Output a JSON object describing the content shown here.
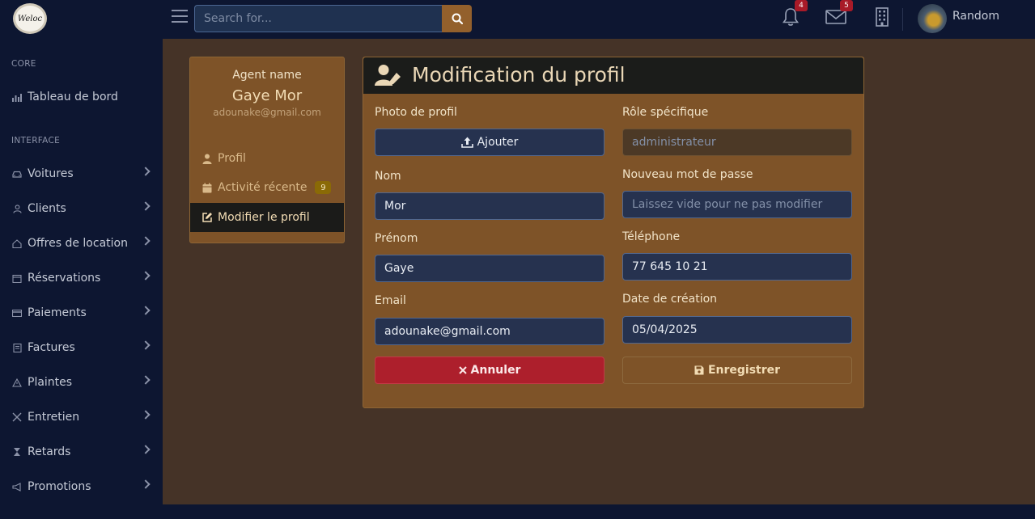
{
  "brand": {
    "logo_text": "Weloc"
  },
  "sidebar": {
    "core_heading": "CORE",
    "dashboard_label": "Tableau de bord",
    "interface_heading": "INTERFACE",
    "items": [
      {
        "label": "Voitures",
        "icon": "car-icon"
      },
      {
        "label": "Clients",
        "icon": "user-icon"
      },
      {
        "label": "Offres de location",
        "icon": "home-icon"
      },
      {
        "label": "Réservations",
        "icon": "calendar-icon"
      },
      {
        "label": "Paiements",
        "icon": "credit-card-icon"
      },
      {
        "label": "Factures",
        "icon": "invoice-icon"
      },
      {
        "label": "Plaintes",
        "icon": "warning-icon"
      },
      {
        "label": "Entretien",
        "icon": "tools-icon"
      },
      {
        "label": "Retards",
        "icon": "hourglass-icon"
      },
      {
        "label": "Promotions",
        "icon": "megaphone-icon"
      }
    ]
  },
  "topbar": {
    "search_placeholder": "Search for...",
    "notifications_count": "4",
    "messages_count": "5",
    "username": "Random"
  },
  "profile_card": {
    "heading": "Agent name",
    "name": "Gaye Mor",
    "email": "adounake@gmail.com",
    "menu": {
      "profile": "Profil",
      "activity": "Activité récente",
      "activity_count": "9",
      "edit": "Modifier le profil"
    }
  },
  "form": {
    "title": "Modification du profil",
    "photo_label": "Photo de profil",
    "upload_label": "Ajouter",
    "role_label": "Rôle spécifique",
    "role_placeholder": "administrateur",
    "nom_label": "Nom",
    "nom_value": "Mor",
    "password_label": "Nouveau mot de passe",
    "password_placeholder": "Laissez vide pour ne pas modifier",
    "prenom_label": "Prénom",
    "prenom_value": "Gaye",
    "telephone_label": "Téléphone",
    "telephone_value": "77 645 10 21",
    "email_label": "Email",
    "email_value": "adounake@gmail.com",
    "date_label": "Date de création",
    "date_value": "05/04/2025",
    "cancel_label": "Annuler",
    "save_label": "Enregistrer"
  },
  "colors": {
    "sidebar_bg": "#0d1631",
    "page_bg": "#453327",
    "card_bg": "#7e5328",
    "accent": "#93602c",
    "danger": "#ad1f2c"
  }
}
